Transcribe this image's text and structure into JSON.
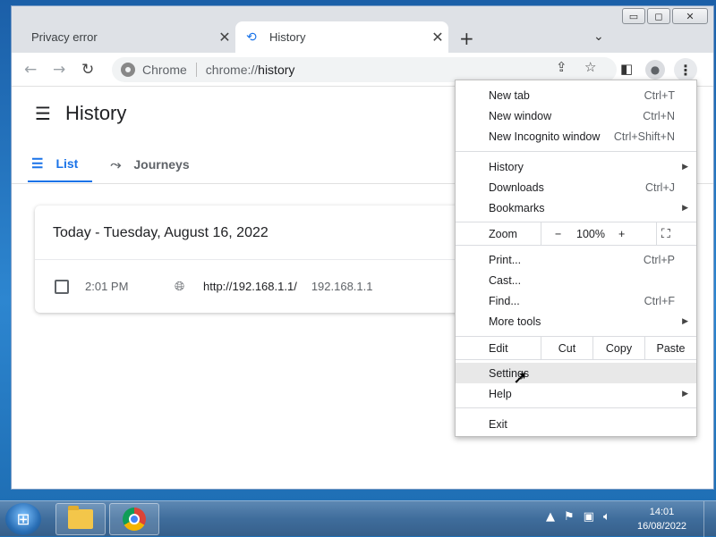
{
  "browser": {
    "tabs": [
      {
        "title": "Privacy error",
        "active": false
      },
      {
        "title": "History",
        "active": true
      }
    ],
    "new_tab_symbol": "+",
    "omnibox": {
      "site_name": "Chrome",
      "url_prefix": "chrome://",
      "url_path": "history"
    }
  },
  "page": {
    "title": "History",
    "tabs": [
      {
        "label": "List",
        "icon": "list-icon"
      },
      {
        "label": "Journeys",
        "icon": "journeys-icon"
      }
    ],
    "card": {
      "date": "Today - Tuesday, August 16, 2022",
      "entries": [
        {
          "time": "2:01 PM",
          "title": "http://192.168.1.1/",
          "domain": "192.168.1.1"
        }
      ]
    }
  },
  "menu": {
    "new_tab": {
      "label": "New tab",
      "shortcut": "Ctrl+T"
    },
    "new_window": {
      "label": "New window",
      "shortcut": "Ctrl+N"
    },
    "new_incognito": {
      "label": "New Incognito window",
      "shortcut": "Ctrl+Shift+N"
    },
    "history": {
      "label": "History"
    },
    "downloads": {
      "label": "Downloads",
      "shortcut": "Ctrl+J"
    },
    "bookmarks": {
      "label": "Bookmarks"
    },
    "zoom": {
      "label": "Zoom",
      "minus": "−",
      "value": "100%",
      "plus": "+"
    },
    "print": {
      "label": "Print...",
      "shortcut": "Ctrl+P"
    },
    "cast": {
      "label": "Cast..."
    },
    "find": {
      "label": "Find...",
      "shortcut": "Ctrl+F"
    },
    "more_tools": {
      "label": "More tools"
    },
    "edit": {
      "label": "Edit",
      "cut": "Cut",
      "copy": "Copy",
      "paste": "Paste"
    },
    "settings": {
      "label": "Settings"
    },
    "help": {
      "label": "Help"
    },
    "exit": {
      "label": "Exit"
    }
  },
  "taskbar": {
    "clock_time": "14:01",
    "clock_date": "16/08/2022"
  },
  "colors": {
    "accent": "#1a73e8",
    "tabstrip": "#dee1e6"
  }
}
